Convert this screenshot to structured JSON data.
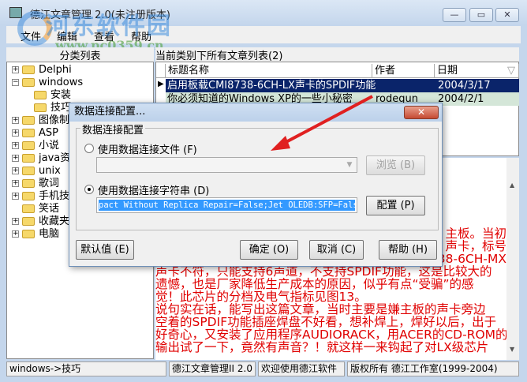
{
  "window": {
    "title": "德江文章管理 2.0(未注册版本)",
    "min": "—",
    "max": "▭",
    "close": "✕"
  },
  "watermark": {
    "name": "河东软件园",
    "url": "www.pc0359.cn"
  },
  "menu": [
    "文件",
    "编辑",
    "查看",
    "帮助"
  ],
  "left": {
    "header": "分类列表",
    "tree": [
      {
        "label": "Delphi",
        "toggle": "+"
      },
      {
        "label": "windows",
        "toggle": "−"
      },
      {
        "label": "安装",
        "toggle": ""
      },
      {
        "label": "技巧",
        "toggle": ""
      },
      {
        "label": "图像制作",
        "toggle": "+"
      },
      {
        "label": "ASP",
        "toggle": "+"
      },
      {
        "label": "小说",
        "toggle": "+"
      },
      {
        "label": "java资料",
        "toggle": "+"
      },
      {
        "label": "unix",
        "toggle": "+"
      },
      {
        "label": "歌词",
        "toggle": "+"
      },
      {
        "label": "手机技巧",
        "toggle": "+"
      },
      {
        "label": "笑话",
        "toggle": ""
      },
      {
        "label": "收藏夹",
        "toggle": "+"
      },
      {
        "label": "电脑",
        "toggle": "+"
      }
    ]
  },
  "right": {
    "header": "当前类别下所有文章列表(2)",
    "columns": [
      "标题名称",
      "作者",
      "日期"
    ],
    "sort_icon": "▽",
    "rows": [
      {
        "title": "启用板载CMI8738-6CH-LX声卡的SPDIF功能",
        "author": "",
        "date": "2004/3/17"
      },
      {
        "title": "你必须知道的Windows XP的一些小秘密",
        "author": "rodegun",
        "date": "2004/2/1"
      }
    ],
    "partial_lines": [
      "主板。当初",
      "声卡，标号",
      "38-6CH-MX"
    ],
    "lines": [
      "声卡不符，只能支持6声道，不支持SPDIF功能，这是比较大的",
      "遗憾，也是厂家降低生产成本的原因，似乎有点“受骗”的感",
      "觉！此芯片的分档及电气指标见图13。",
      "说句实在话，能写出这篇文章，当时主要是嫌主板的声卡旁边",
      "空着的SPDIF功能插座焊盘不好看，想补焊上，焊好以后，出于",
      "好奇心，又安装了应用程序AUDIORACK，用ACER的CD-ROM的数字",
      "输出试了一下，竟然有声音？！就这样一来钩起了对LX级芯片"
    ]
  },
  "status": [
    "windows->技巧",
    "德江文章管理II 2.0",
    "欢迎使用德江软件",
    "版权所有 德江工作室(1999-2004)"
  ],
  "dialog": {
    "title": "数据连接配置...",
    "close": "✕",
    "group": "数据连接配置",
    "radio_file": "使用数据连接文件 (F)",
    "file_value": "",
    "browse": "浏览 (B)",
    "radio_string": "使用数据连接字符串 (D)",
    "string_value": "pact Without Replica Repair=False;Jet OLEDB:SFP=False;",
    "config": "配置 (P)",
    "default": "默认值 (E)",
    "ok": "确定 (O)",
    "cancel": "取消 (C)",
    "help": "帮助 (H)"
  },
  "colors": {
    "selection": "#0a246a",
    "text_red": "#e00000",
    "arrow": "#e02020"
  }
}
